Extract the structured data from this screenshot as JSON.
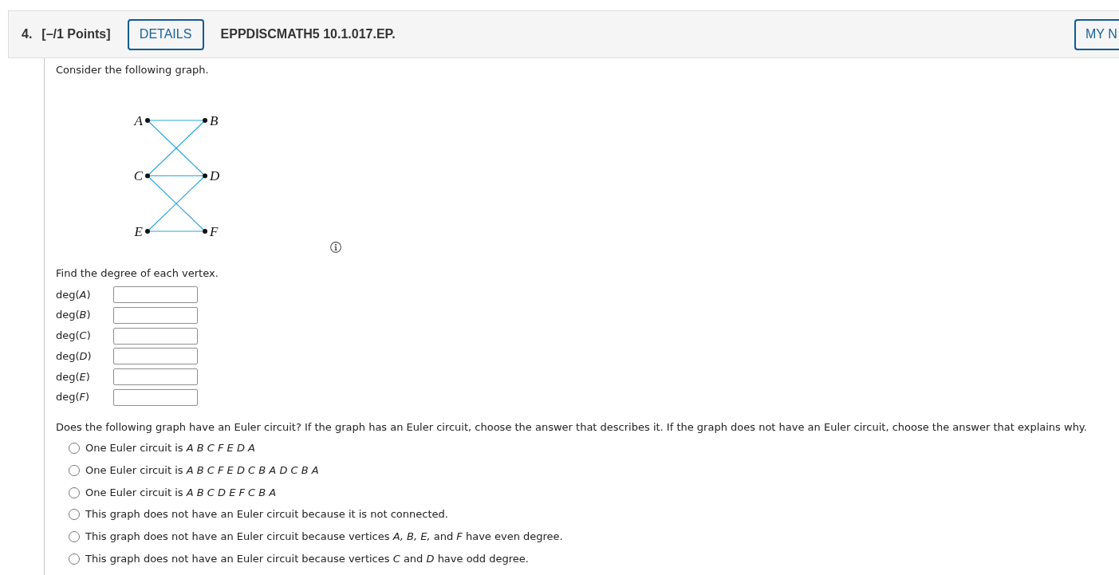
{
  "question_header": {
    "number": "4.",
    "points": "[–/1 Points]",
    "details_button": "DETAILS",
    "code": "EPPDISCMATH5 10.1.017.EP.",
    "right_button": "MY N"
  },
  "intro": "Consider the following graph.",
  "graph": {
    "rows": [
      {
        "left": "A",
        "right": "B",
        "across": true,
        "cross_to_next": true
      },
      {
        "left": "C",
        "right": "D",
        "across": true,
        "cross_to_next": true
      },
      {
        "left": "E",
        "right": "F",
        "across": true
      }
    ]
  },
  "degree_prompt": "Find the degree of each vertex.",
  "degree_fields": [
    {
      "label": "deg(*A*)"
    },
    {
      "label": "deg(*B*)"
    },
    {
      "label": "deg(*C*)"
    },
    {
      "label": "deg(*D*)"
    },
    {
      "label": "deg(*E*)"
    },
    {
      "label": "deg(*F*)"
    }
  ],
  "euler_question": "Does the following graph have an Euler circuit? If the graph has an Euler circuit, choose the answer that describes it. If the graph does not have an Euler circuit, choose the answer that explains why.",
  "options": [
    {
      "text": "One Euler circuit is *A B C F E D A*",
      "selected": false
    },
    {
      "text": "One Euler circuit is *A B C F E D C B A D C B A*",
      "selected": false
    },
    {
      "text": "One Euler circuit is *A B C D E F C B A*",
      "selected": false
    },
    {
      "text": "This graph does not have an Euler circuit because it is not connected.",
      "selected": false
    },
    {
      "text": "This graph does not have an Euler circuit because vertices *A, B, E,* and *F* have even degree.",
      "selected": false
    },
    {
      "text": "This graph does not have an Euler circuit because vertices *C* and *D* have odd degree.",
      "selected": false
    }
  ]
}
